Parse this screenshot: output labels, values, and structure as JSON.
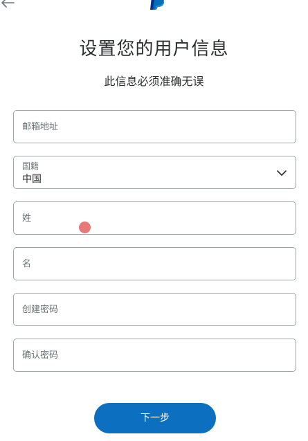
{
  "header": {
    "back_icon": "back-arrow-icon",
    "logo_icon": "paypal-logo-icon",
    "logo_color": "#003087"
  },
  "title": "设置您的用户信息",
  "subtitle": "此信息必须准确无误",
  "form": {
    "email": {
      "placeholder": "邮箱地址"
    },
    "nationality": {
      "label": "国籍",
      "value": "中国",
      "icon": "chevron-down-icon"
    },
    "last_name": {
      "placeholder": "姓"
    },
    "first_name": {
      "placeholder": "名"
    },
    "password": {
      "placeholder": "创建密码"
    },
    "confirm_password": {
      "placeholder": "确认密码"
    }
  },
  "next_button": {
    "label": "下一步",
    "color": "#0c6fbf"
  },
  "colors": {
    "border": "#9da3a6",
    "text": "#2c2e2f",
    "muted": "#687173"
  }
}
